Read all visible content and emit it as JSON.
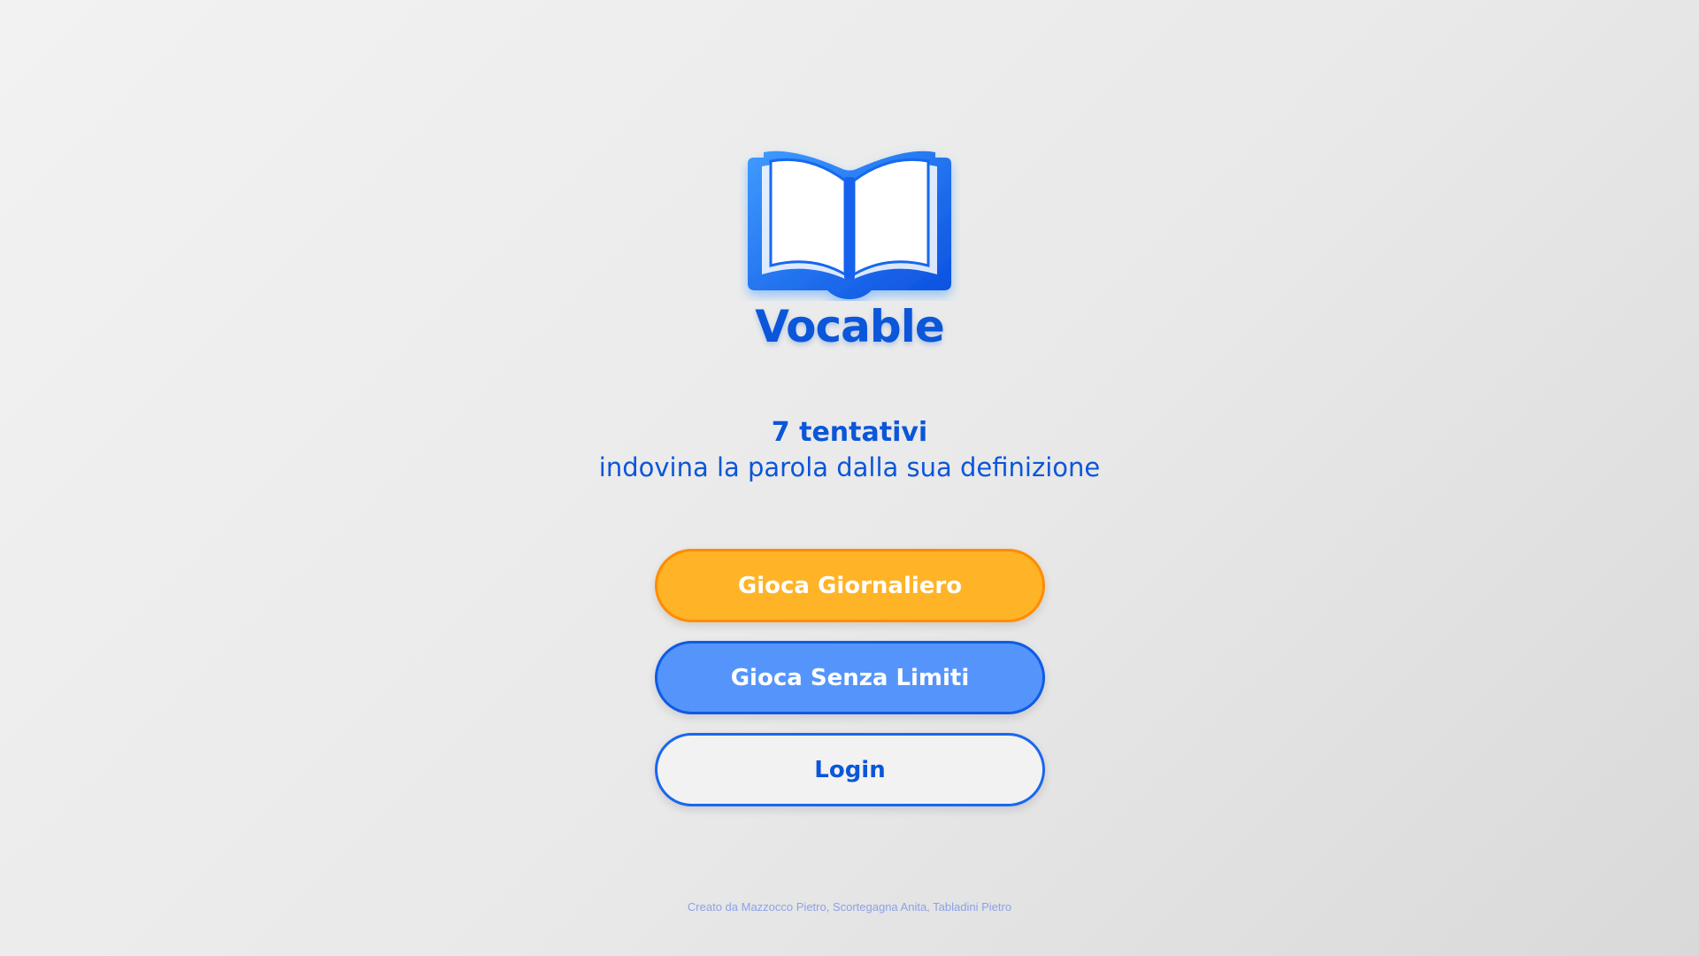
{
  "app": {
    "title": "Vocable",
    "logo_icon": "open-book-icon",
    "brand_color": "#0b56d9"
  },
  "intro": {
    "attempts": "7 tentativi",
    "description": "indovina la parola dalla sua definizione"
  },
  "buttons": {
    "daily": "Gioca Giornaliero",
    "unlimited": "Gioca Senza Limiti",
    "login": "Login"
  },
  "colors": {
    "daily_fill": "#ffb327",
    "daily_border": "#ff8c00",
    "unlimited_fill": "#5595fb",
    "unlimited_border": "#0e5be6",
    "login_border": "#1a66f0"
  },
  "footer": {
    "credits": "Creato da Mazzocco Pietro, Scortegagna Anita, Tabladini Pietro"
  }
}
